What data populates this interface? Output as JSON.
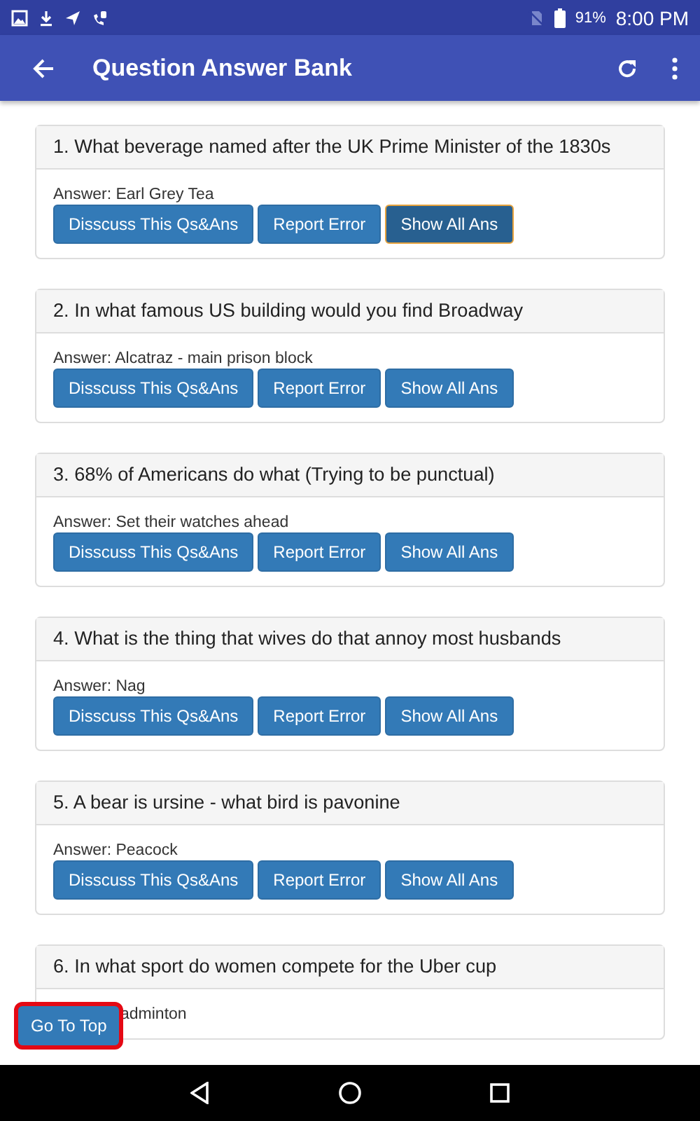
{
  "status_bar": {
    "battery": "91%",
    "time": "8:00 PM"
  },
  "app_bar": {
    "title": "Question Answer Bank"
  },
  "cards": [
    {
      "question": "1. What beverage named after the UK Prime Minister of the 1830s",
      "answer": "Answer: Earl Grey Tea",
      "buttons": [
        {
          "label": "Disscuss This Qs&Ans",
          "selected": false
        },
        {
          "label": "Report Error",
          "selected": false
        },
        {
          "label": "Show All Ans",
          "selected": true
        }
      ]
    },
    {
      "question": "2. In what famous US building would you find Broadway",
      "answer": "Answer: Alcatraz - main prison block",
      "buttons": [
        {
          "label": "Disscuss This Qs&Ans",
          "selected": false
        },
        {
          "label": "Report Error",
          "selected": false
        },
        {
          "label": "Show All Ans",
          "selected": false
        }
      ]
    },
    {
      "question": "3. 68% of Americans do what (Trying to be punctual)",
      "answer": "Answer: Set their watches ahead",
      "buttons": [
        {
          "label": "Disscuss This Qs&Ans",
          "selected": false
        },
        {
          "label": "Report Error",
          "selected": false
        },
        {
          "label": "Show All Ans",
          "selected": false
        }
      ]
    },
    {
      "question": "4. What is the thing that wives do that annoy most husbands",
      "answer": "Answer: Nag",
      "buttons": [
        {
          "label": "Disscuss This Qs&Ans",
          "selected": false
        },
        {
          "label": "Report Error",
          "selected": false
        },
        {
          "label": "Show All Ans",
          "selected": false
        }
      ]
    },
    {
      "question": "5. A bear is ursine - what bird is pavonine",
      "answer": "Answer: Peacock",
      "buttons": [
        {
          "label": "Disscuss This Qs&Ans",
          "selected": false
        },
        {
          "label": "Report Error",
          "selected": false
        },
        {
          "label": "Show All Ans",
          "selected": false
        }
      ]
    },
    {
      "question": "6. In what sport do women compete for the Uber cup",
      "answer": "adminton"
    }
  ],
  "go_to_top": {
    "label": "Go To Top"
  }
}
